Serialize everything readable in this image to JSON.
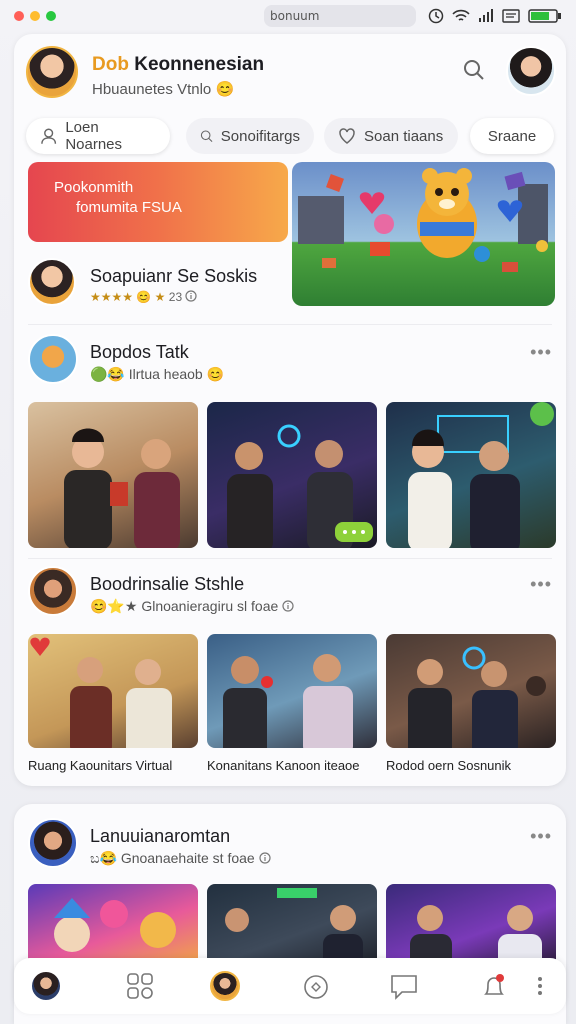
{
  "status_bar": {
    "url_text": "bonuum",
    "window_dots": [
      "#ff5f57",
      "#febc2e",
      "#28c840"
    ]
  },
  "header": {
    "name_prefix": "Dob",
    "name": "Keonnenesian",
    "subtitle": "Hbuaunetes Vtnlo",
    "subtitle_emoji": "😊"
  },
  "filters": [
    {
      "label": "Loen Noarnes",
      "icon": "user-icon",
      "active": true
    },
    {
      "label": "Sonoifitargs",
      "icon": "search-icon",
      "active": false
    },
    {
      "label": "Soan tiaans",
      "icon": "heart-icon",
      "active": false
    },
    {
      "label": "Sraane",
      "icon": "",
      "active": true
    }
  ],
  "banner": {
    "line1": "Pookonmith",
    "line2": "fomumita FSUA"
  },
  "featured_card": {
    "title": "Soapuianr Se Soskis",
    "rating_text": "★★★★",
    "rating_emoji": "😊",
    "star": "★",
    "count": "23"
  },
  "posts": [
    {
      "title": "Bopdos Tatk",
      "sub_icons": "🟢😂",
      "subtitle": "Ilrtua heaob",
      "sub_emoji": "😊",
      "more": "•••"
    },
    {
      "title": "Boodrinsalie Stshle",
      "sub_icons": "😊⭐★",
      "subtitle": "Glnoanieragiru sl foae",
      "more": "•••",
      "captions": [
        "Ruang Kaounitars Virtual",
        "Konanitans Kanoon iteaoe",
        "Rodod oern Sosnunik"
      ]
    },
    {
      "title": "Lanuuianaromtan",
      "sub_icons": "ಬ😂",
      "subtitle": "Gnoanaehaite st foae",
      "more": "•••"
    }
  ],
  "colors": {
    "accent": "#e89a20",
    "banner_start": "#e5464f",
    "banner_end": "#f7a94a",
    "panel_bg": "#fbfbfd"
  },
  "bottom_nav": [
    "profile",
    "groups",
    "avatar-center",
    "home",
    "chat",
    "notifications",
    "more"
  ]
}
